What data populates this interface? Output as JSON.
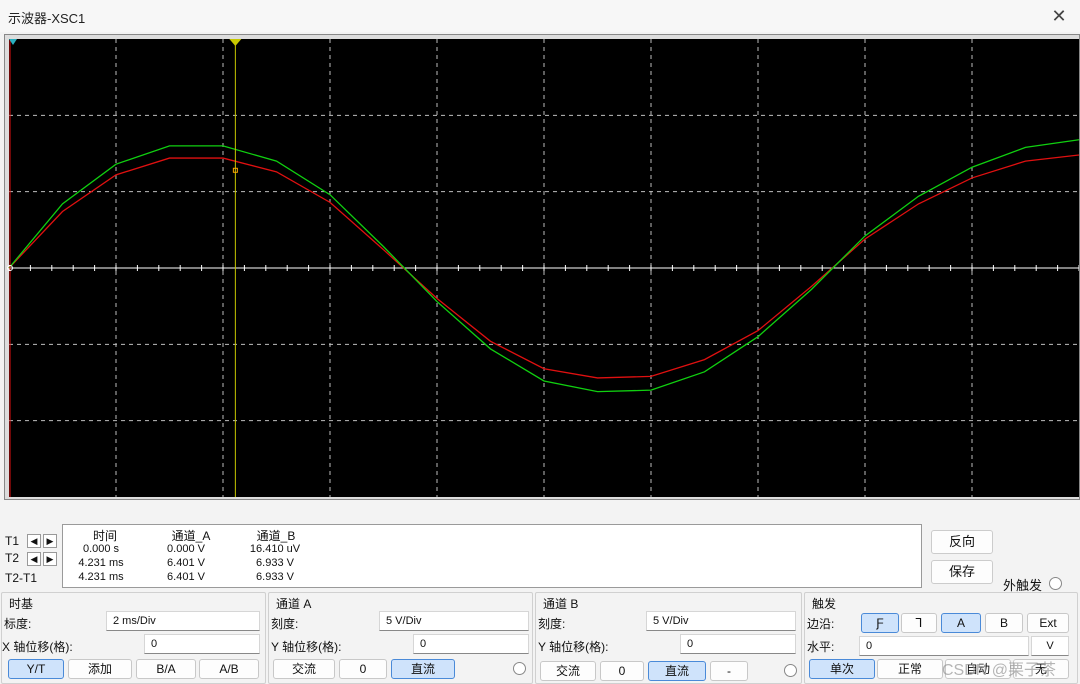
{
  "window": {
    "title": "示波器-XSC1"
  },
  "colors": {
    "screen_bg": "#000000",
    "grid": "#bdbdbd",
    "channel_a": "#e01010",
    "channel_b": "#10d010",
    "cursor_t2": "#c8c800"
  },
  "cursors": {
    "t1_label": "T1",
    "t2_label": "T2",
    "diff_label": "T2-T1"
  },
  "readout": {
    "headers": [
      "时间",
      "通道_A",
      "通道_B"
    ],
    "rows": [
      [
        "0.000 s",
        "0.000 V",
        "16.410 uV"
      ],
      [
        "4.231 ms",
        "6.401 V",
        "6.933 V"
      ],
      [
        "4.231 ms",
        "6.401 V",
        "6.933 V"
      ]
    ]
  },
  "side": {
    "reverse": "反向",
    "save": "保存",
    "ext_trigger": "外触发"
  },
  "timebase": {
    "title": "时基",
    "scale_label": "标度:",
    "scale": "2 ms/Div",
    "xpos_label": "X 轴位移(格):",
    "xpos": "0",
    "buttons": [
      "Y/T",
      "添加",
      "B/A",
      "A/B"
    ]
  },
  "channel_a": {
    "title": "通道 A",
    "scale_label": "刻度:",
    "scale": "5  V/Div",
    "ypos_label": "Y 轴位移(格):",
    "ypos": "0",
    "coupling": [
      "交流",
      "0",
      "直流"
    ]
  },
  "channel_b": {
    "title": "通道 B",
    "scale_label": "刻度:",
    "scale": "5  V/Div",
    "ypos_label": "Y 轴位移(格):",
    "ypos": "0",
    "coupling": [
      "交流",
      "0",
      "直流",
      "-"
    ]
  },
  "trigger": {
    "title": "触发",
    "edge_label": "边沿:",
    "edge_buttons": [
      "Ƒ",
      "Ꞁ",
      "A",
      "B",
      "Ext"
    ],
    "level_label": "水平:",
    "level": "0",
    "level_unit": "V",
    "mode_buttons": [
      "单次",
      "正常",
      "自动",
      "无"
    ]
  },
  "watermark": "CSDN @栗子茶",
  "chart_data": {
    "type": "line",
    "xlabel": "",
    "ylabel": "",
    "time_per_div_ms": 2,
    "volts_per_div": 5,
    "divisions_x": 10,
    "divisions_y": 6,
    "x_ms": [
      0,
      1,
      2,
      3,
      4,
      5,
      6,
      7,
      8,
      9,
      10,
      11,
      12,
      13,
      14,
      15,
      16,
      17,
      18,
      19,
      20
    ],
    "series": [
      {
        "name": "通道_A",
        "values": [
          0,
          3.7,
          6.1,
          7.2,
          7.2,
          6.3,
          4.3,
          1.2,
          -2.0,
          -4.8,
          -6.6,
          -7.2,
          -7.1,
          -6.0,
          -4.1,
          -1.2,
          1.9,
          4.2,
          5.9,
          7.0,
          7.4
        ]
      },
      {
        "name": "通道_B",
        "values": [
          0,
          4.2,
          6.8,
          8.0,
          8.0,
          7.0,
          4.8,
          1.4,
          -2.2,
          -5.3,
          -7.4,
          -8.1,
          -8.0,
          -6.8,
          -4.5,
          -1.4,
          2.1,
          4.7,
          6.6,
          7.9,
          8.4
        ]
      }
    ]
  }
}
